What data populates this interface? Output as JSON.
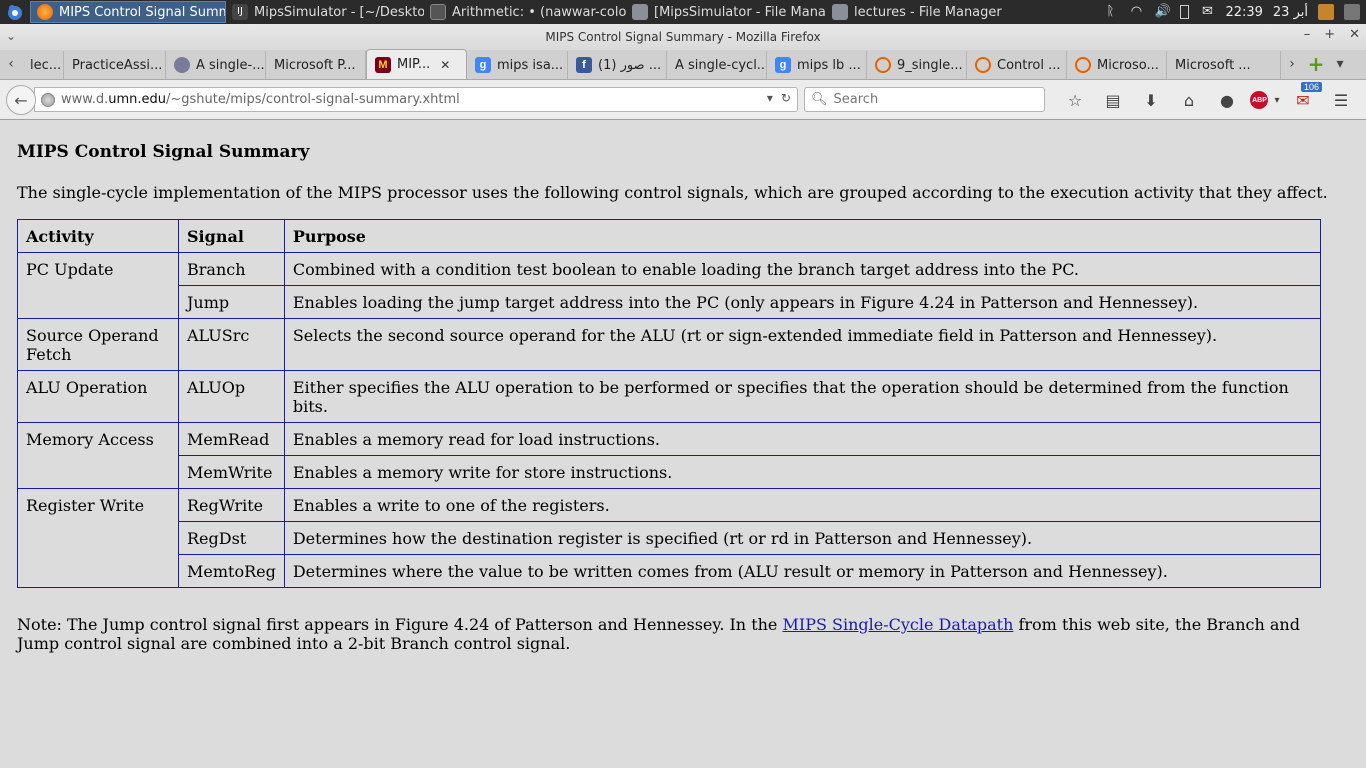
{
  "panel": {
    "tasks": [
      {
        "label": "MIPS Control Signal Summ...",
        "active": true
      },
      {
        "label": "MipsSimulator - [~/Deskto..."
      },
      {
        "label": "Arithmetic: • (nawwar-colo..."
      },
      {
        "label": "[MipsSimulator - File Mana..."
      },
      {
        "label": "lectures - File Manager"
      }
    ],
    "clock": "22:39",
    "date": "23 أبر"
  },
  "window": {
    "title": "MIPS Control Signal Summary - Mozilla Firefox"
  },
  "tabs": [
    {
      "label": "lec...",
      "fav": "#c8c8c8",
      "glyph": ""
    },
    {
      "label": "PracticeAssi...",
      "fav": "",
      "glyph": ""
    },
    {
      "label": "A single-...",
      "fav": "#7a7a9a",
      "glyph": ""
    },
    {
      "label": "Microsoft P...",
      "fav": "",
      "glyph": ""
    },
    {
      "label": "MIP...",
      "fav": "#7a0019",
      "glyph": "M",
      "active": true
    },
    {
      "label": "mips isa...",
      "fav": "#4285f4",
      "glyph": "g"
    },
    {
      "label": "صور (1) ...",
      "fav": "#3b5998",
      "glyph": "f"
    },
    {
      "label": "A single-cycl...",
      "fav": "",
      "glyph": ""
    },
    {
      "label": "mips lb ...",
      "fav": "#4285f4",
      "glyph": "g"
    },
    {
      "label": "9_single...",
      "fav": "#e66000",
      "glyph": "○"
    },
    {
      "label": "Control ...",
      "fav": "#e66000",
      "glyph": "○"
    },
    {
      "label": "Microso...",
      "fav": "#e66000",
      "glyph": "○"
    },
    {
      "label": "Microsoft ...",
      "fav": "",
      "glyph": ""
    }
  ],
  "nav": {
    "url_prefix": "www.d.",
    "url_domain": "umn.edu",
    "url_path": "/~gshute/mips/control-signal-summary.xhtml",
    "search_placeholder": "Search",
    "gmail_count": "106"
  },
  "page": {
    "title": "MIPS Control Signal Summary",
    "intro": "The single-cycle implementation of the MIPS processor uses the following control signals, which are grouped according to the execution activity that they affect.",
    "headers": {
      "activity": "Activity",
      "signal": "Signal",
      "purpose": "Purpose"
    },
    "groups": [
      {
        "activity": "PC Update",
        "rows": [
          {
            "signal": "Branch",
            "purpose": "Combined with a condition test boolean to enable loading the branch target address into the PC."
          },
          {
            "signal": "Jump",
            "purpose": "Enables loading the jump target address into the PC (only appears in Figure 4.24 in Patterson and Hennessey)."
          }
        ]
      },
      {
        "activity": "Source Operand Fetch",
        "rows": [
          {
            "signal": "ALUSrc",
            "purpose": "Selects the second source operand for the ALU (rt or sign-extended immediate field in Patterson and Hennessey)."
          }
        ]
      },
      {
        "activity": "ALU Operation",
        "rows": [
          {
            "signal": "ALUOp",
            "purpose": "Either specifies the ALU operation to be performed or specifies that the operation should be determined from the function bits."
          }
        ]
      },
      {
        "activity": "Memory Access",
        "rows": [
          {
            "signal": "MemRead",
            "purpose": "Enables a memory read for load instructions."
          },
          {
            "signal": "MemWrite",
            "purpose": "Enables a memory write for store instructions."
          }
        ]
      },
      {
        "activity": "Register Write",
        "rows": [
          {
            "signal": "RegWrite",
            "purpose": "Enables a write to one of the registers."
          },
          {
            "signal": "RegDst",
            "purpose": "Determines how the destination register is specified (rt or rd in Patterson and Hennessey)."
          },
          {
            "signal": "MemtoReg",
            "purpose": "Determines where the value to be written comes from (ALU result or memory in Patterson and Hennessey)."
          }
        ]
      }
    ],
    "note_before": "Note: The Jump control signal first appears in Figure 4.24 of Patterson and Hennessey. In the ",
    "note_link": "MIPS Single-Cycle Datapath",
    "note_after": " from this web site, the Branch and Jump control signal are combined into a 2-bit Branch control signal."
  }
}
